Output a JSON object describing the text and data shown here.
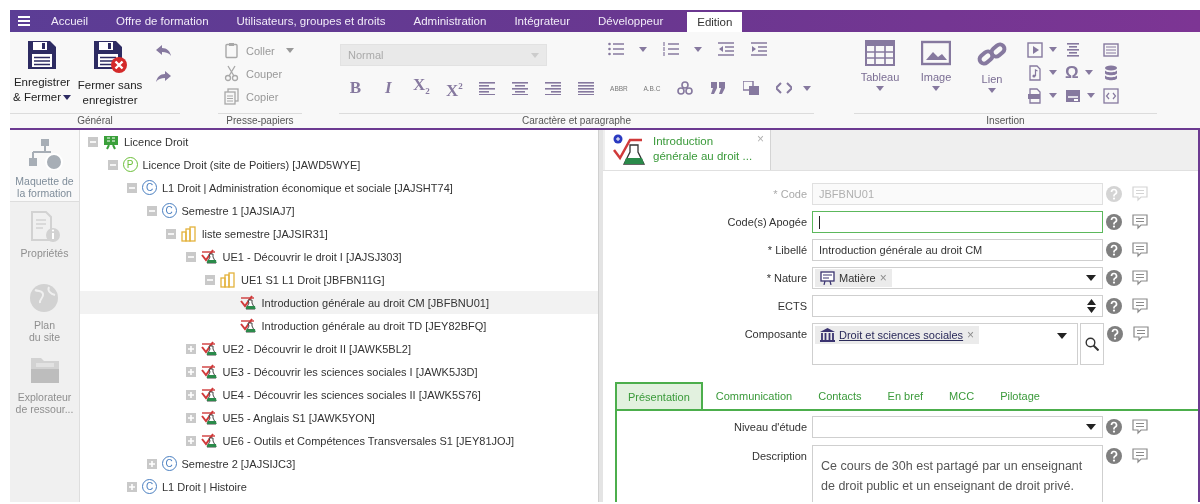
{
  "nav": {
    "tabs": [
      {
        "label": "Accueil",
        "selected": false
      },
      {
        "label": "Offre de formation",
        "selected": false
      },
      {
        "label": "Utilisateurs, groupes et droits",
        "selected": false
      },
      {
        "label": "Administration",
        "selected": false
      },
      {
        "label": "Intégrateur",
        "selected": false
      },
      {
        "label": "Développeur",
        "selected": false
      },
      {
        "label": "Edition",
        "selected": true
      }
    ]
  },
  "ribbon": {
    "general": {
      "title": "Général",
      "buttons": [
        {
          "label": "Enregistrer\n& Fermer",
          "kind": "save",
          "dropdown": true
        },
        {
          "label": "Fermer sans\nenregistrer",
          "kind": "discard",
          "dropdown": false
        }
      ]
    },
    "clipboard": {
      "title": "Presse-papiers",
      "items": [
        {
          "label": "Coller",
          "kind": "paste",
          "disabled": true,
          "dropdown": true
        },
        {
          "label": "Couper",
          "kind": "cut",
          "disabled": true,
          "dropdown": false
        },
        {
          "label": "Copier",
          "kind": "copy",
          "disabled": true,
          "dropdown": false
        }
      ]
    },
    "formatting": {
      "title": "Caractère et paragraphe",
      "style_select": {
        "value": "Normal",
        "disabled": true
      },
      "text_buttons": [
        "B",
        "I",
        "X$_{2}$",
        "X$^{2}$"
      ],
      "abbr_buttons": [
        "ABBR",
        "A.B.C"
      ]
    },
    "insertion": {
      "title": "Insertion",
      "buttons": [
        {
          "label": "Tableau",
          "kind": "table"
        },
        {
          "label": "Image",
          "kind": "image"
        },
        {
          "label": "Lien",
          "kind": "link"
        }
      ],
      "special_char": "Ω"
    }
  },
  "sidebar": {
    "items": [
      {
        "label": "Maquette de\nla formation",
        "kind": "sitemap",
        "selected": true,
        "disabled": false
      },
      {
        "label": "Propriétés",
        "kind": "properties",
        "selected": false,
        "disabled": true
      },
      {
        "label": "Plan\ndu site",
        "kind": "globe",
        "selected": false,
        "disabled": true
      },
      {
        "label": "Explorateur\nde ressour...",
        "kind": "folder",
        "selected": false,
        "disabled": true
      }
    ]
  },
  "tree": {
    "items": [
      {
        "label": "Licence Droit",
        "kind": "program",
        "expanded": true,
        "selected": false,
        "children": [
          {
            "label": "Licence Droit (site de Poitiers) [JAWD5WYE]",
            "kind": "parcours",
            "letter": "P",
            "expanded": true,
            "selected": false,
            "children": [
              {
                "label": "L1 Droit | Administration économique et sociale [JAJSHT74]",
                "kind": "container",
                "letter": "C",
                "expanded": true,
                "selected": false,
                "children": [
                  {
                    "label": "Semestre 1 [JAJSIAJ7]",
                    "kind": "container",
                    "letter": "C",
                    "expanded": true,
                    "selected": false,
                    "children": [
                      {
                        "label": "liste semestre [JAJSIR31]",
                        "kind": "list",
                        "expanded": true,
                        "selected": false,
                        "children": [
                          {
                            "label": "UE1 - Découvrir le droit I [JAJSJ303]",
                            "kind": "course",
                            "expanded": true,
                            "selected": false,
                            "children": [
                              {
                                "label": "UE1 S1 L1 Droit [JBFBN11G]",
                                "kind": "list",
                                "expanded": true,
                                "selected": false,
                                "children": [
                                  {
                                    "label": "Introduction générale au droit CM [JBFBNU01]",
                                    "kind": "course",
                                    "selected": true
                                  },
                                  {
                                    "label": "Introduction générale au droit TD [JEY82BFQ]",
                                    "kind": "course",
                                    "selected": false
                                  }
                                ]
                              }
                            ]
                          },
                          {
                            "label": "UE2 - Découvrir le droit II [JAWK5BL2]",
                            "kind": "course",
                            "expanded": false,
                            "selected": false
                          },
                          {
                            "label": "UE3 - Découvrir les sciences sociales I [JAWK5J3D]",
                            "kind": "course",
                            "expanded": false,
                            "selected": false
                          },
                          {
                            "label": "UE4 - Découvrir les sciences sociales II [JAWK5S76]",
                            "kind": "course",
                            "expanded": false,
                            "selected": false
                          },
                          {
                            "label": "UE5 - Anglais S1 [JAWK5YON]",
                            "kind": "course",
                            "expanded": false,
                            "selected": false
                          },
                          {
                            "label": "UE6 - Outils et Compétences Transversales S1 [JEY81JOJ]",
                            "kind": "course",
                            "expanded": false,
                            "selected": false
                          }
                        ]
                      }
                    ]
                  },
                  {
                    "label": "Semestre 2 [JAJSIJC3]",
                    "kind": "container",
                    "letter": "C",
                    "expanded": false,
                    "selected": false
                  }
                ]
              },
              {
                "label": "L1 Droit | Histoire",
                "kind": "container",
                "letter": "C",
                "expanded": false,
                "selected": false
              }
            ]
          }
        ]
      }
    ]
  },
  "editor": {
    "tab": {
      "title": "Introduction\ngénérale au droit ...",
      "close": "×"
    },
    "fields": [
      {
        "label": "* Code",
        "kind": "text",
        "value": "JBFBNU01",
        "disabled": true,
        "focused": false
      },
      {
        "label": "Code(s) Apogée",
        "kind": "text",
        "disabled": false,
        "focused": true
      },
      {
        "label": "* Libellé",
        "kind": "text",
        "value": "Introduction générale au droit CM",
        "disabled": false,
        "focused": false
      },
      {
        "label": "* Nature",
        "kind": "tags",
        "tag": {
          "label": "Matière",
          "remove": "×",
          "kind": "subject"
        },
        "disabled": false,
        "focused": false
      },
      {
        "label": "ECTS",
        "kind": "number",
        "disabled": false,
        "focused": false
      },
      {
        "label": "Composante",
        "kind": "lookup",
        "tag": {
          "label": "Droit et sciences sociales",
          "remove": "×",
          "kind": "institution"
        },
        "disabled": false,
        "focused": false
      }
    ],
    "subtabs": [
      {
        "label": "Présentation",
        "selected": true
      },
      {
        "label": "Communication",
        "selected": false
      },
      {
        "label": "Contacts",
        "selected": false
      },
      {
        "label": "En bref",
        "selected": false
      },
      {
        "label": "MCC",
        "selected": false
      },
      {
        "label": "Pilotage",
        "selected": false
      }
    ],
    "subfields": [
      {
        "label": "Niveau d'étude",
        "kind": "select",
        "disabled": false,
        "focused": false
      },
      {
        "label": "Description",
        "kind": "textarea",
        "value": "Ce cours de 30h est partagé par un enseignant de droit public et un enseignant de droit privé.",
        "disabled": false,
        "focused": false
      }
    ]
  }
}
